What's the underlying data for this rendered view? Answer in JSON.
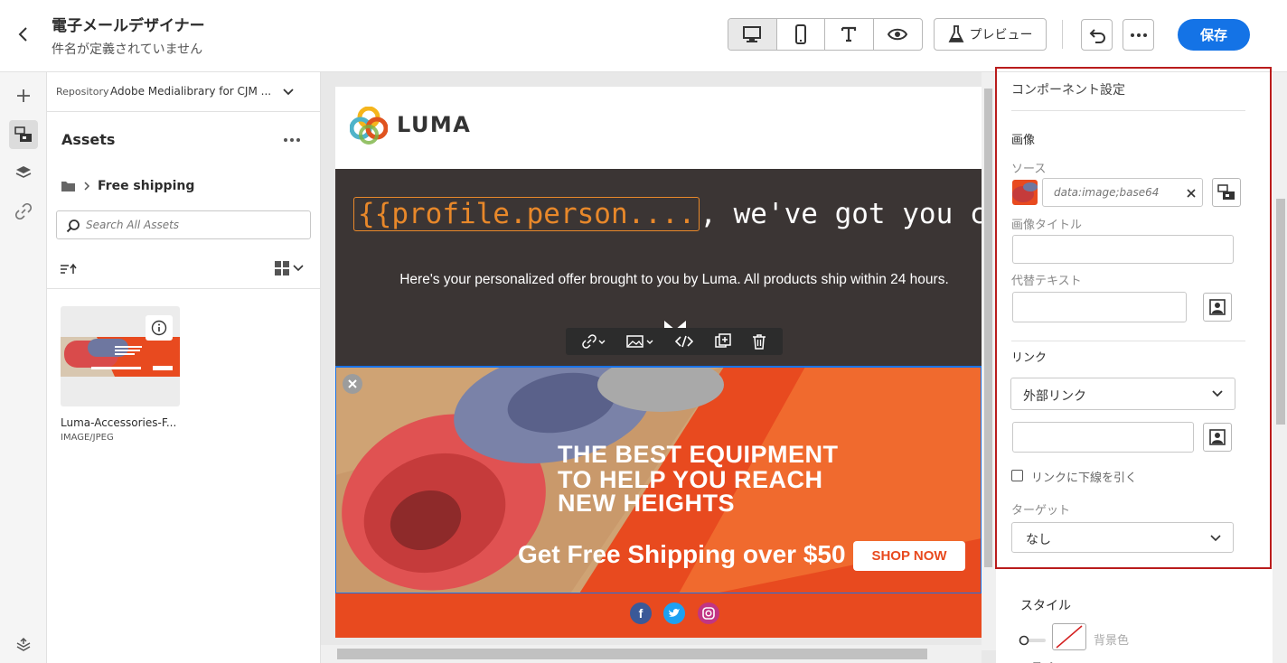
{
  "header": {
    "title": "電子メールデザイナー",
    "subtitle": "件名が定義されていません",
    "preview_label": "プレビュー",
    "save_label": "保存"
  },
  "assets_panel": {
    "repository_label": "Repository",
    "repository_value": "Adobe Medialibrary for CJM ...",
    "title": "Assets",
    "folder": "Free shipping",
    "search_placeholder": "Search All Assets",
    "asset": {
      "name": "Luma-Accessories-F...",
      "type": "IMAGE/JPEG"
    }
  },
  "email": {
    "brand": "LUMA",
    "headline_token": "{{profile.person....",
    "headline_rest": ", we've got you covered",
    "body": "Here's your personalized offer brought to you by Luma. All products ship within 24 hours.",
    "banner_line1": "THE BEST EQUIPMENT",
    "banner_line2": "TO HELP YOU REACH",
    "banner_line3": "NEW HEIGHTS",
    "banner_shipping": "Get Free Shipping over $50",
    "banner_cta": "SHOP NOW"
  },
  "properties": {
    "title": "コンポーネント設定",
    "image_section": "画像",
    "source_label": "ソース",
    "source_value": "data:image;base64",
    "image_title_label": "画像タイトル",
    "alt_text_label": "代替テキスト",
    "link_section": "リンク",
    "link_type": "外部リンク",
    "underline_label": "リンクに下線を引く",
    "target_label": "ターゲット",
    "target_value": "なし",
    "style_section": "スタイル",
    "background_label": "背景色",
    "next_partial": "スペ"
  },
  "colors": {
    "accent": "#1473e6",
    "highlight": "#b91c1c",
    "hero_bg": "#3b3534",
    "banner_orange": "#e84a1f",
    "token_orange": "#e8882a"
  }
}
